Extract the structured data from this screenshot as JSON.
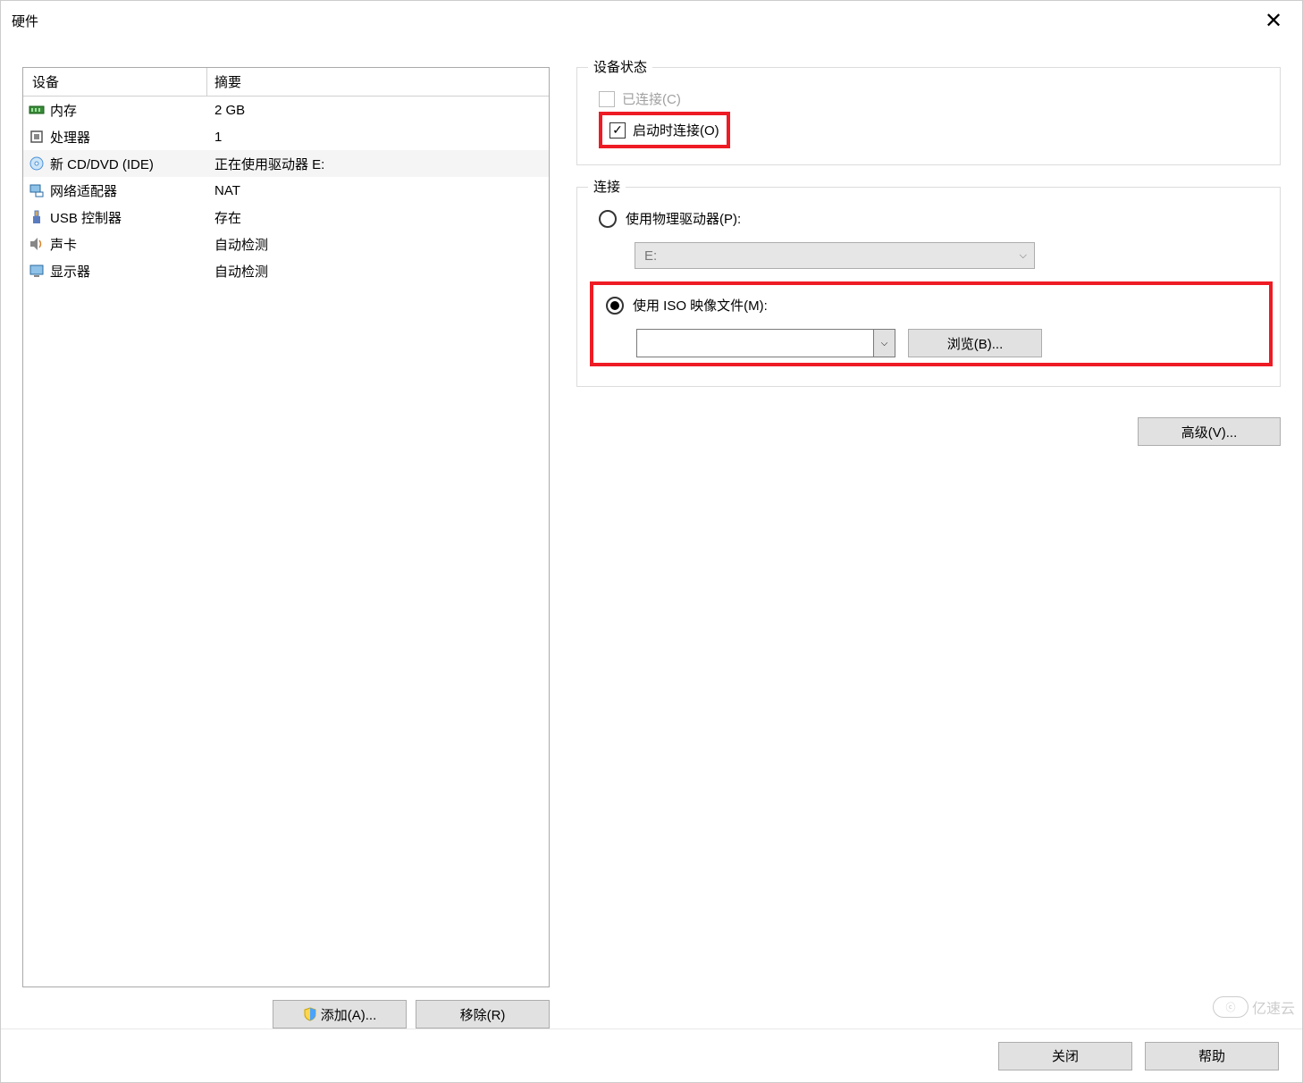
{
  "window": {
    "title": "硬件",
    "close_label": "✕"
  },
  "device_list": {
    "col_device": "设备",
    "col_summary": "摘要",
    "rows": [
      {
        "icon": "memory-icon",
        "name": "内存",
        "summary": "2 GB",
        "selected": false
      },
      {
        "icon": "cpu-icon",
        "name": "处理器",
        "summary": "1",
        "selected": false
      },
      {
        "icon": "cd-icon",
        "name": "新 CD/DVD (IDE)",
        "summary": "正在使用驱动器 E:",
        "selected": true
      },
      {
        "icon": "network-icon",
        "name": "网络适配器",
        "summary": "NAT",
        "selected": false
      },
      {
        "icon": "usb-icon",
        "name": "USB 控制器",
        "summary": "存在",
        "selected": false
      },
      {
        "icon": "sound-icon",
        "name": "声卡",
        "summary": "自动检测",
        "selected": false
      },
      {
        "icon": "display-icon",
        "name": "显示器",
        "summary": "自动检测",
        "selected": false
      }
    ]
  },
  "left_buttons": {
    "add": "添加(A)...",
    "remove": "移除(R)"
  },
  "device_state": {
    "group": "设备状态",
    "connected": "已连接(C)",
    "connect_on_power": "启动时连接(O)"
  },
  "connection": {
    "group": "连接",
    "physical": "使用物理驱动器(P):",
    "physical_value": "E:",
    "iso": "使用 ISO 映像文件(M):",
    "iso_value": "",
    "browse": "浏览(B)..."
  },
  "advanced": "高级(V)...",
  "footer": {
    "close": "关闭",
    "help": "帮助"
  },
  "watermark": "亿速云"
}
